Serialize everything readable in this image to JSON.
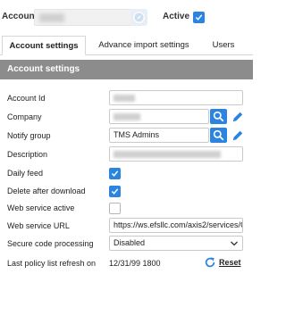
{
  "top": {
    "account_label": "Account",
    "active_label": "Active",
    "active_checked": true
  },
  "tabs": [
    {
      "label": "Account settings",
      "active": true
    },
    {
      "label": "Advance import settings",
      "active": false
    },
    {
      "label": "Users",
      "active": false
    }
  ],
  "section": {
    "title": "Account settings"
  },
  "fields": {
    "account_id": {
      "label": "Account Id"
    },
    "company": {
      "label": "Company"
    },
    "notify_group": {
      "label": "Notify group",
      "value": "TMS Admins"
    },
    "description": {
      "label": "Description"
    },
    "daily_feed": {
      "label": "Daily feed",
      "checked": true
    },
    "delete_after_download": {
      "label": "Delete after download",
      "checked": true
    },
    "web_service_active": {
      "label": "Web service active",
      "checked": false
    },
    "web_service_url": {
      "label": "Web service URL",
      "value": "https://ws.efsllc.com/axis2/services/C"
    },
    "secure_code_processing": {
      "label": "Secure code processing",
      "value": "Disabled"
    },
    "last_policy_refresh": {
      "label": "Last policy list refresh on",
      "value": "12/31/99 1800",
      "reset_label": "Reset"
    }
  },
  "colors": {
    "accent": "#2b84e0",
    "header_bg": "#8c8c8c"
  },
  "icons": [
    "compass-icon",
    "checkmark-icon",
    "search-icon",
    "pencil-icon",
    "chevron-down-icon",
    "refresh-icon"
  ]
}
